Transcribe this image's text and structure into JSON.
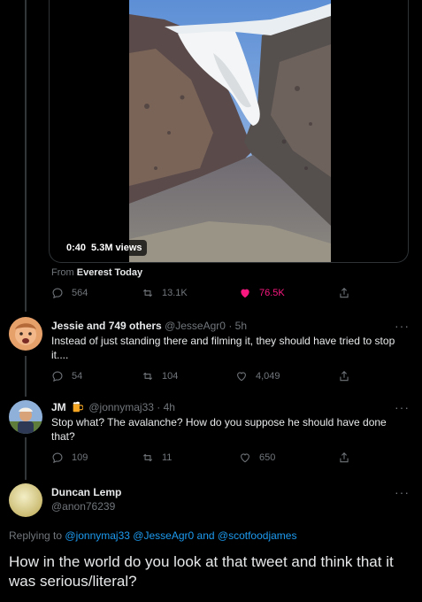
{
  "video": {
    "duration": "0:40",
    "views": "5.3M views"
  },
  "source": {
    "prefix": "From",
    "name": "Everest Today"
  },
  "main_tweet_actions": {
    "replies": "564",
    "retweets": "13.1K",
    "likes": "76.5K",
    "like_active_color": "#f91880"
  },
  "replies": [
    {
      "name": "Jessie and 749 others",
      "handle": "@JesseAgr0",
      "time": "5h",
      "text": "Instead of just standing there and filming it, they should have tried to stop it....",
      "replies": "54",
      "retweets": "104",
      "likes": "4,049"
    },
    {
      "name": "JM",
      "badge_icon": "beer-emoji",
      "handle": "@jonnymaj33",
      "time": "4h",
      "text": "Stop what? The avalanche? How do you suppose he should have done that?",
      "replies": "109",
      "retweets": "11",
      "likes": "650"
    }
  ],
  "focused_reply": {
    "name": "Duncan Lemp",
    "handle": "@anon76239",
    "replying_prefix": "Replying to",
    "mentions": [
      "@jonnymaj33",
      "@JesseAgr0",
      "@scotfoodjames"
    ],
    "and_word": "and",
    "text": "How in the world do you look at that tweet and think that it was serious/literal?"
  },
  "colors": {
    "background": "#000000",
    "text_primary": "#e7e9ea",
    "text_secondary": "#71767b",
    "link": "#1d9bf0"
  },
  "more_glyph": "···"
}
